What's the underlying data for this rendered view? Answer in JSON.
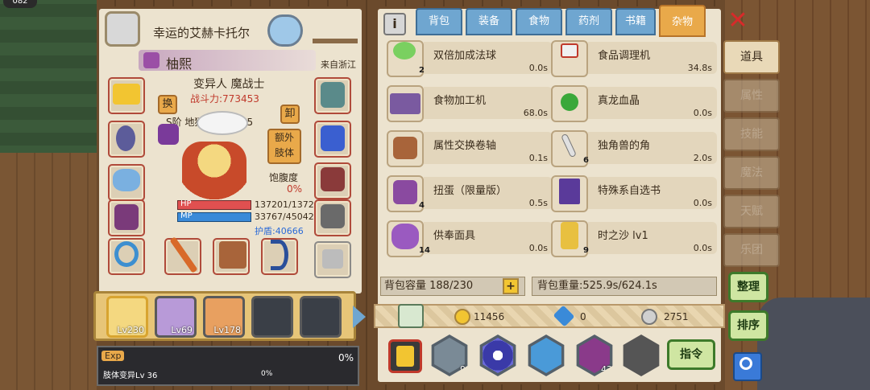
{
  "character": {
    "name": "幸运的艾赫卡托尔",
    "player_name": "柚熙",
    "origin": "来自浙江",
    "class": "变异人 魔战士",
    "power_label": "战斗力:773453",
    "swap_label": "换",
    "unequip_label": "卸",
    "extra_body_label": "额外\n肢体",
    "rank_text": "S阶 地狱使者 Lv 85",
    "satiety_label": "饱腹度",
    "satiety_value": "0%",
    "hp_label": "HP",
    "hp_value": "137201/1372",
    "mp_label": "MP",
    "mp_value": "33767/45042",
    "shield_value": "护盾:40666",
    "exp_label": "Exp",
    "exp_percent": "0%",
    "mutation_label": "肢体变异Lv 36",
    "mutation_percent": "0%",
    "party": [
      {
        "level": "Lv230"
      },
      {
        "level": "Lv69"
      },
      {
        "level": "Lv178"
      },
      {
        "level": ""
      },
      {
        "level": ""
      }
    ]
  },
  "tabs": [
    {
      "label": "背包"
    },
    {
      "label": "装备"
    },
    {
      "label": "食物"
    },
    {
      "label": "药剂"
    },
    {
      "label": "书籍"
    },
    {
      "label": "杂物"
    }
  ],
  "items": [
    {
      "name": "双倍加成法球",
      "time": "0.0s",
      "count": "2"
    },
    {
      "name": "食品调理机",
      "time": "34.8s",
      "count": ""
    },
    {
      "name": "食物加工机",
      "time": "68.0s",
      "count": ""
    },
    {
      "name": "真龙血晶",
      "time": "0.0s",
      "count": ""
    },
    {
      "name": "属性交换卷轴",
      "time": "0.1s",
      "count": ""
    },
    {
      "name": "独角兽的角",
      "time": "2.0s",
      "count": "6"
    },
    {
      "name": "扭蛋（限量版）",
      "time": "0.5s",
      "count": "4"
    },
    {
      "name": "特殊系自选书",
      "time": "0.0s",
      "count": ""
    },
    {
      "name": "供奉面具",
      "time": "0.0s",
      "count": "14"
    },
    {
      "name": "时之沙 lv1",
      "time": "0.0s",
      "count": "9"
    }
  ],
  "bag": {
    "capacity": "背包容量 188/230",
    "weight": "背包重量:525.9s/624.1s",
    "gold": "11456",
    "gems": "0",
    "silver": "2751"
  },
  "side_menu": [
    {
      "label": "道具"
    },
    {
      "label": "属性"
    },
    {
      "label": "技能"
    },
    {
      "label": "魔法"
    },
    {
      "label": "天赋"
    },
    {
      "label": "乐团"
    }
  ],
  "buttons": {
    "organize": "整理",
    "sort": "排序",
    "command": "指令",
    "close": "✕",
    "info": "i",
    "add": "+"
  },
  "quick_slots": [
    {
      "count": "9"
    },
    {
      "count": ""
    },
    {
      "count": ""
    },
    {
      "count": "43"
    }
  ],
  "top_left_badge": "082"
}
